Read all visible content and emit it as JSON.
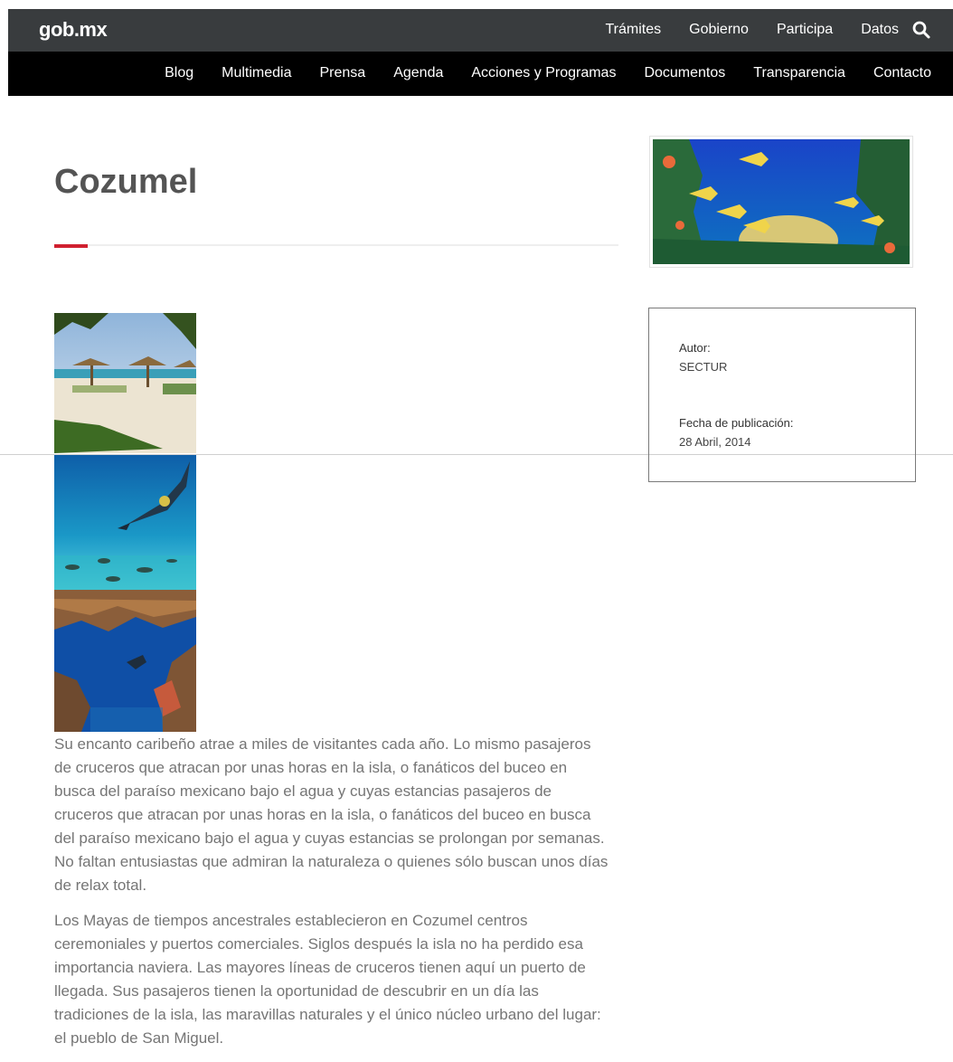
{
  "header": {
    "logo": "gob.mx",
    "top_links": [
      "Trámites",
      "Gobierno",
      "Participa",
      "Datos"
    ],
    "nav_links": [
      "Blog",
      "Multimedia",
      "Prensa",
      "Agenda",
      "Acciones y Programas",
      "Documentos",
      "Transparencia",
      "Contacto"
    ]
  },
  "main": {
    "title": "Cozumel",
    "paragraphs": [
      "Su encanto caribeño atrae a miles de visitantes cada año. Lo mismo pasajeros de cruceros que atracan por unas horas en la isla, o fanáticos del buceo en busca del paraíso mexicano bajo el agua y cuyas estancias pasajeros de cruceros que atracan por unas horas en la isla, o fanáticos del buceo en busca del paraíso mexicano bajo el agua y cuyas estancias se prolongan por semanas. No faltan entusiastas que admiran la naturaleza o quienes sólo buscan unos días de relax total.",
      "Los Mayas de tiempos ancestrales establecieron en Cozumel centros ceremoniales y puertos comerciales. Siglos después la isla no ha perdido esa importancia naviera. Las mayores líneas de cruceros tienen aquí un puerto de llegada. Sus pasajeros tienen la oportunidad de descubrir en un día las tradiciones de la isla, las maravillas naturales y el único núcleo urbano del lugar: el pueblo de San Miguel."
    ]
  },
  "sidebar": {
    "author_label": "Autor:",
    "author_value": "SECTUR",
    "date_label": "Fecha de publicación:",
    "date_value": "28 Abril, 2014"
  },
  "colors": {
    "topbar": "#393c3e",
    "navbar": "#000000",
    "accent": "#d0202f",
    "text": "#545454"
  },
  "icons": {
    "search": "search-icon"
  }
}
